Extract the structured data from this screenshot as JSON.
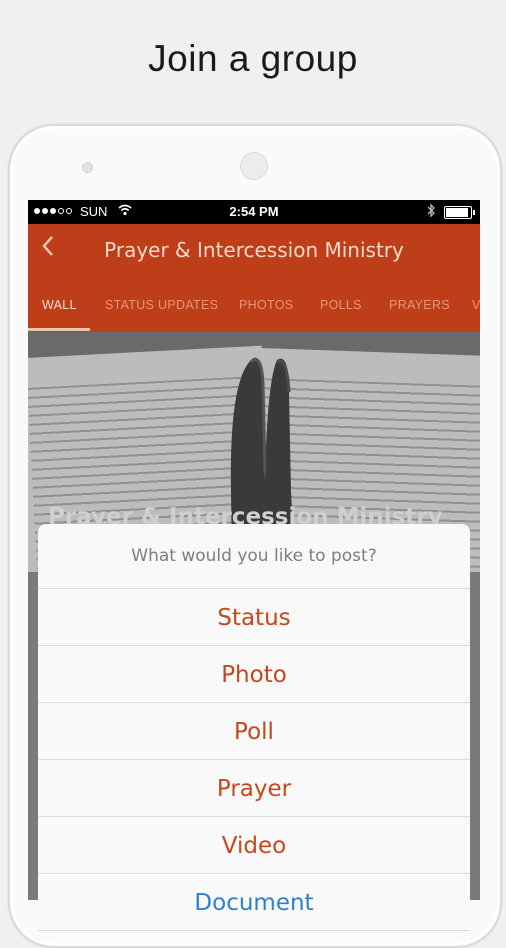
{
  "headline": "Join a group",
  "status_bar": {
    "carrier": "SUN",
    "time": "2:54 PM",
    "wifi_icon": "wifi-icon",
    "bluetooth_icon": "bluetooth-icon",
    "battery_level": 0.9
  },
  "app_bar": {
    "back_icon": "chevron-left-icon",
    "title": "Prayer & Intercession Ministry",
    "color": "#bd3e18"
  },
  "tabs": [
    {
      "label": "WALL",
      "active": true
    },
    {
      "label": "STATUS UPDATES",
      "active": false
    },
    {
      "label": "PHOTOS",
      "active": false
    },
    {
      "label": "POLLS",
      "active": false
    },
    {
      "label": "PRAYERS",
      "active": false
    },
    {
      "label": "V",
      "active": false
    }
  ],
  "cover": {
    "title": "Prayer & Intercession Ministry"
  },
  "post_sheet": {
    "prompt": "What would you like to post?",
    "options": [
      "Status",
      "Photo",
      "Poll",
      "Prayer",
      "Video",
      "Document"
    ],
    "option_color": "#c7471c",
    "link_color": "#2c7fd3"
  }
}
